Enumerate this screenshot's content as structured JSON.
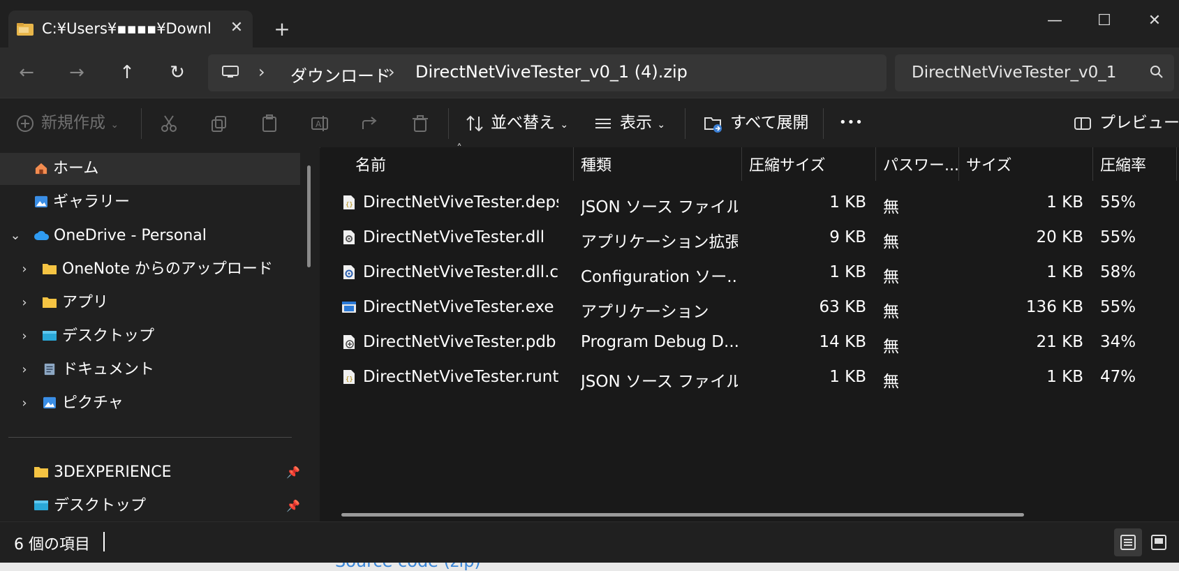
{
  "window": {
    "tab_title": "C:¥Users¥▪▪▪▪¥Downl",
    "tab_close": "✕",
    "tab_add": "+",
    "minimize": "—",
    "maximize": "☐",
    "close": "✕"
  },
  "nav": {
    "back": "←",
    "forward": "→",
    "up": "↑",
    "refresh": "↻",
    "breadcrumb": [
      "ダウンロード",
      "DirectNetViveTester_v0_1 (4).zip"
    ],
    "chevron": "›",
    "search_value": "DirectNetViveTester_v0_1"
  },
  "commands": {
    "new": "新規作成",
    "sort": "並べ替え",
    "view": "表示",
    "extract_all": "すべて展開",
    "more": "•••",
    "preview": "プレビュー"
  },
  "sidebar": {
    "items": [
      {
        "label": "ホーム",
        "icon": "home-icon"
      },
      {
        "label": "ギャラリー",
        "icon": "gallery-icon"
      },
      {
        "label": "OneDrive - Personal",
        "icon": "cloud-icon"
      },
      {
        "label": "OneNote からのアップロード",
        "icon": "folder-icon"
      },
      {
        "label": "アプリ",
        "icon": "folder-icon"
      },
      {
        "label": "デスクトップ",
        "icon": "desktop-icon"
      },
      {
        "label": "ドキュメント",
        "icon": "document-icon"
      },
      {
        "label": "ピクチャ",
        "icon": "pictures-icon"
      }
    ],
    "pinned": [
      {
        "label": "3DEXPERIENCE",
        "icon": "folder-icon"
      },
      {
        "label": "デスクトップ",
        "icon": "desktop-icon"
      }
    ]
  },
  "table": {
    "columns": [
      "名前",
      "種類",
      "圧縮サイズ",
      "パスワー...",
      "サイズ",
      "圧縮率"
    ],
    "rows": [
      {
        "name": "DirectNetViveTester.deps....",
        "type": "JSON ソース ファイル",
        "packed": "1 KB",
        "pw": "無",
        "size": "1 KB",
        "ratio": "55%",
        "icon": "json-file-icon"
      },
      {
        "name": "DirectNetViveTester.dll",
        "type": "アプリケーション拡張",
        "packed": "9 KB",
        "pw": "無",
        "size": "20 KB",
        "ratio": "55%",
        "icon": "dll-file-icon"
      },
      {
        "name": "DirectNetViveTester.dll.co...",
        "type": "Configuration ソー...",
        "packed": "1 KB",
        "pw": "無",
        "size": "1 KB",
        "ratio": "58%",
        "icon": "config-file-icon"
      },
      {
        "name": "DirectNetViveTester.exe",
        "type": "アプリケーション",
        "packed": "63 KB",
        "pw": "無",
        "size": "136 KB",
        "ratio": "55%",
        "icon": "exe-file-icon"
      },
      {
        "name": "DirectNetViveTester.pdb",
        "type": "Program Debug D...",
        "packed": "14 KB",
        "pw": "無",
        "size": "21 KB",
        "ratio": "34%",
        "icon": "pdb-file-icon"
      },
      {
        "name": "DirectNetViveTester.runti...",
        "type": "JSON ソース ファイル",
        "packed": "1 KB",
        "pw": "無",
        "size": "1 KB",
        "ratio": "47%",
        "icon": "json-file-icon"
      }
    ]
  },
  "status": {
    "count": "6 個の項目"
  },
  "background": {
    "peek_text": "Source code (zip)"
  }
}
